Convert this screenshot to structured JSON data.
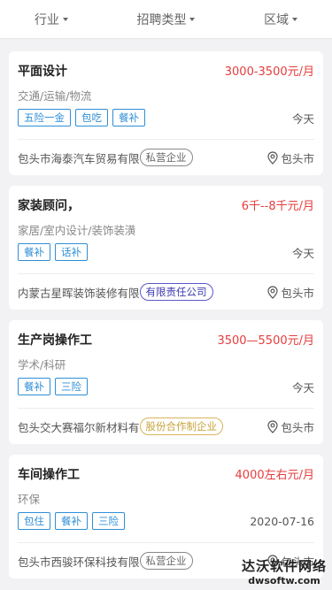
{
  "filters": [
    {
      "label": "行业"
    },
    {
      "label": "招聘类型"
    },
    {
      "label": "区域"
    }
  ],
  "jobs": [
    {
      "title": "平面设计",
      "salary": "3000-3500元/月",
      "industry": "交通/运输/物流",
      "tags": [
        "五险一金",
        "包吃",
        "餐补"
      ],
      "date": "今天",
      "company": "包头市海泰汽车贸易有限",
      "company_type": "私营企业",
      "company_type_style": "private",
      "location": "包头市"
    },
    {
      "title": "家装顾问，",
      "salary": "6千--8千元/月",
      "industry": "家居/室内设计/装饰装潢",
      "tags": [
        "餐补",
        "话补"
      ],
      "date": "今天",
      "company": "内蒙古星晖装饰装修有限",
      "company_type": "有限责任公司",
      "company_type_style": "limited",
      "location": "包头市"
    },
    {
      "title": "生产岗操作工",
      "salary": "3500—5500元/月",
      "industry": "学术/科研",
      "tags": [
        "餐补",
        "三险"
      ],
      "date": "今天",
      "company": "包头交大赛福尔新材料有",
      "company_type": "股份合作制企业",
      "company_type_style": "joint",
      "location": "包头市"
    },
    {
      "title": "车间操作工",
      "salary": "4000左右元/月",
      "industry": "环保",
      "tags": [
        "包住",
        "餐补",
        "三险"
      ],
      "date": "2020-07-16",
      "company": "包头市西骏环保科技有限",
      "company_type": "私营企业",
      "company_type_style": "private",
      "location": "包头市"
    }
  ],
  "watermark": {
    "main": "达沃软件网络",
    "sub": "dwsoftw.com"
  },
  "colors": {
    "salary": "#e63c3c",
    "tag": "#2f8ed6"
  }
}
